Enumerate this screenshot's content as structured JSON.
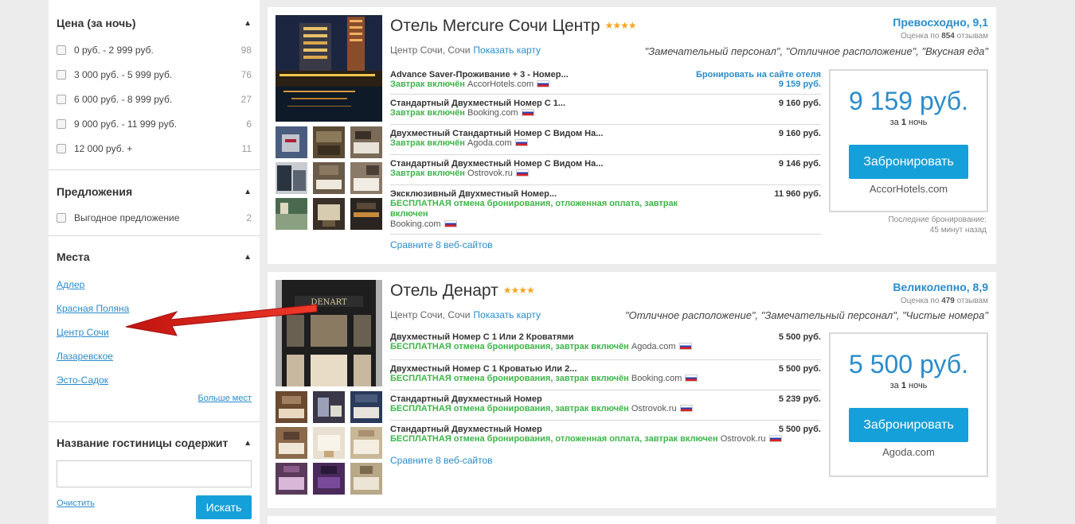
{
  "sidebar": {
    "price": {
      "title": "Цена (за ночь)",
      "options": [
        {
          "label": "0 руб. - 2 999 руб.",
          "count": "98"
        },
        {
          "label": "3 000 руб. - 5 999 руб.",
          "count": "76"
        },
        {
          "label": "6 000 руб. - 8 999 руб.",
          "count": "27"
        },
        {
          "label": "9 000 руб. - 11 999 руб.",
          "count": "6"
        },
        {
          "label": "12 000 руб. +",
          "count": "11"
        }
      ]
    },
    "offers": {
      "title": "Предложения",
      "options": [
        {
          "label": "Выгодное предложение",
          "count": "2"
        }
      ]
    },
    "places": {
      "title": "Места",
      "links": [
        "Адлер",
        "Красная Поляна",
        "Центр Сочи",
        "Лазаревское",
        "Эсто-Садок"
      ],
      "more": "Больше мест"
    },
    "hotel_name": {
      "title": "Название гостиницы содержит",
      "value": "",
      "clear": "Очистить",
      "search": "Искать"
    }
  },
  "hotels": [
    {
      "name": "Отель Mercure Сочи Центр",
      "stars": "★★★★",
      "rating": "Превосходно, 9,1",
      "review_prefix": "Оценка по",
      "review_count": "854",
      "review_suffix": "отзывам",
      "location": "Центр Сочи, Сочи",
      "map_link": "Показать карту",
      "quote": "\"Замечательный персонал\", \"Отличное расположение\", \"Вкусная еда\"",
      "offers": [
        {
          "title": "Advance Saver-Проживание + 3 - Номер...",
          "price": "Бронировать на сайте отеля",
          "price2": "9 159 руб.",
          "green": "Завтрак включён",
          "site": "AccorHotels.com"
        },
        {
          "title": "Стандартный Двухместный Номер С 1...",
          "price": "9 160 руб.",
          "green": "Завтрак включён",
          "site": "Booking.com"
        },
        {
          "title": "Двухместный Стандартный Номер С Видом На...",
          "price": "9 160 руб.",
          "green": "Завтрак включён",
          "site": "Agoda.com"
        },
        {
          "title": "Стандартный Двухместный Номер С Видом На...",
          "price": "9 146 руб.",
          "green": "Завтрак включён",
          "site": "Ostrovok.ru"
        },
        {
          "title": "Эксклюзивный Двухместный Номер...",
          "price": "11 960 руб.",
          "green": "БЕСПЛАТНАЯ отмена бронирования, отложенная оплата, завтрак включен",
          "site": "Booking.com"
        }
      ],
      "compare": "Сравните 8 веб-сайтов",
      "best_price": "9 159 руб.",
      "per_night_prefix": "за",
      "per_night_num": "1",
      "per_night_suffix": "ночь",
      "book": "Забронировать",
      "provider": "AccorHotels.com",
      "recent_label": "Последние бронирование:",
      "recent_time": "45 минут назад"
    },
    {
      "name": "Отель Денарт",
      "stars": "★★★★",
      "rating": "Великолепно, 8,9",
      "review_prefix": "Оценка по",
      "review_count": "479",
      "review_suffix": "отзывам",
      "location": "Центр Сочи, Сочи",
      "map_link": "Показать карту",
      "quote": "\"Отличное расположение\", \"Замечательный персонал\", \"Чистые номера\"",
      "photo_sign": "DENART",
      "offers": [
        {
          "title": "Двухместный Номер С 1 Или 2 Кроватями",
          "price": "5 500 руб.",
          "green": "БЕСПЛАТНАЯ отмена бронирования, завтрак включён",
          "site": "Agoda.com"
        },
        {
          "title": "Двухместный Номер С 1 Кроватью Или 2...",
          "price": "5 500 руб.",
          "green": "БЕСПЛАТНАЯ отмена бронирования, завтрак включён",
          "site": "Booking.com"
        },
        {
          "title": "Стандартный Двухместный Номер",
          "price": "5 239 руб.",
          "green": "БЕСПЛАТНАЯ отмена бронирования, завтрак включён",
          "site": "Ostrovok.ru"
        },
        {
          "title": "Стандартный Двухместный Номер",
          "price": "5 500 руб.",
          "green": "БЕСПЛАТНАЯ отмена бронирования, отложенная оплата, завтрак включен",
          "site": "Ostrovok.ru"
        }
      ],
      "compare": "Сравните 8 веб-сайтов",
      "best_price": "5 500 руб.",
      "per_night_prefix": "за",
      "per_night_num": "1",
      "per_night_suffix": "ночь",
      "book": "Забронировать",
      "provider": "Agoda.com"
    }
  ],
  "colors": {
    "accent": "#2a8ccb",
    "button": "#16a0d9",
    "green": "#3eb54a",
    "star": "#f5a623",
    "arrow": "#e0201a"
  }
}
